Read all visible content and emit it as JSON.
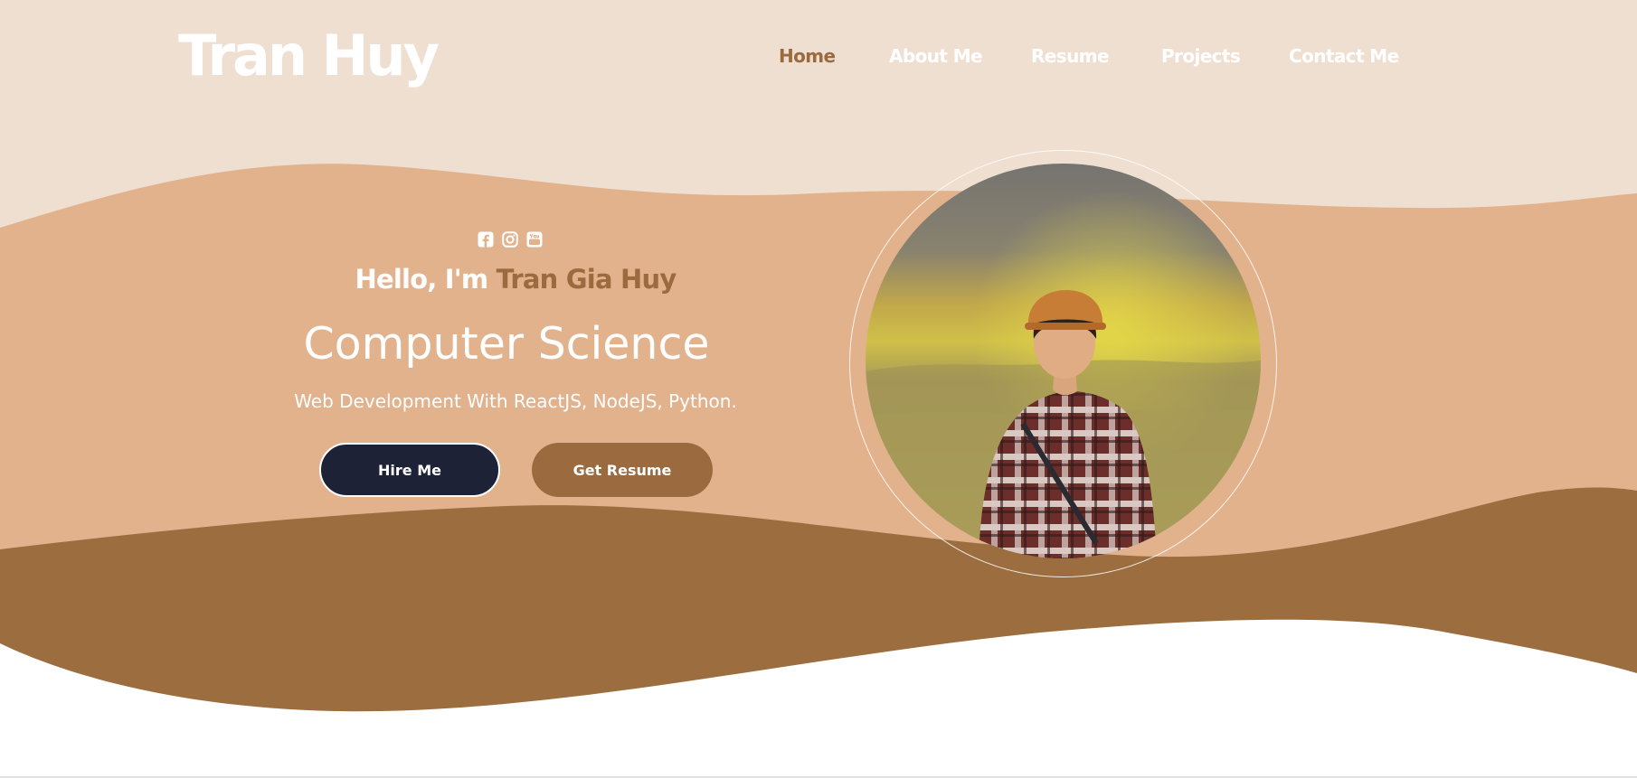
{
  "header": {
    "logo": "Tran Huy",
    "nav": [
      {
        "label": "Home",
        "active": true
      },
      {
        "label": "About Me",
        "active": false
      },
      {
        "label": "Resume",
        "active": false
      },
      {
        "label": "Projects",
        "active": false
      },
      {
        "label": "Contact Me",
        "active": false
      }
    ]
  },
  "hero": {
    "social_icons": [
      "facebook-icon",
      "instagram-icon",
      "youtube-icon"
    ],
    "greeting_prefix": "Hello, I'm",
    "greeting_name": "Tran Gia Huy",
    "headline": "Computer Science",
    "subtitle": "Web Development With ReactJS, NodeJS, Python.",
    "primary_button": "Hire Me",
    "secondary_button": "Get Resume"
  },
  "colors": {
    "top_background": "#efdfd0",
    "middle_wave": "#e2b28d",
    "bottom_wave": "#9b6d3f",
    "accent_brown": "#9b6b3f",
    "dark_button": "#1e2236",
    "text_white": "#ffffff"
  }
}
